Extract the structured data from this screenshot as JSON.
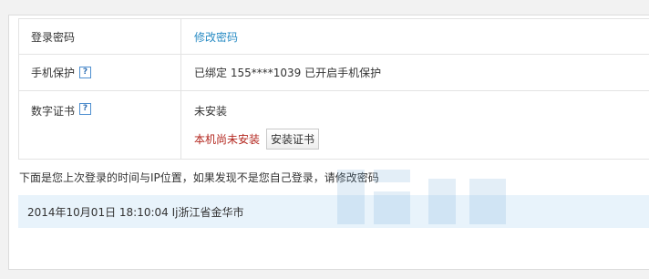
{
  "security": {
    "rows": [
      {
        "label": "登录密码",
        "value": "修改密码"
      },
      {
        "label": "手机保护",
        "help": "?",
        "value": "已绑定 155****1039 已开启手机保护"
      },
      {
        "label": "数字证书",
        "help": "?",
        "status": "未安装",
        "warning": "本机尚未安装",
        "button": "安装证书"
      }
    ]
  },
  "last_login": {
    "note": "下面是您上次登录的时间与IP位置，如果发现不是您自己登录，请修改密码",
    "record": "2014年10月01日  18:10:04  Ij浙江省金华市"
  },
  "colors": {
    "link": "#2a8cc4",
    "warning": "#b3261e",
    "login_bar_bg": "#e8f3fb"
  }
}
